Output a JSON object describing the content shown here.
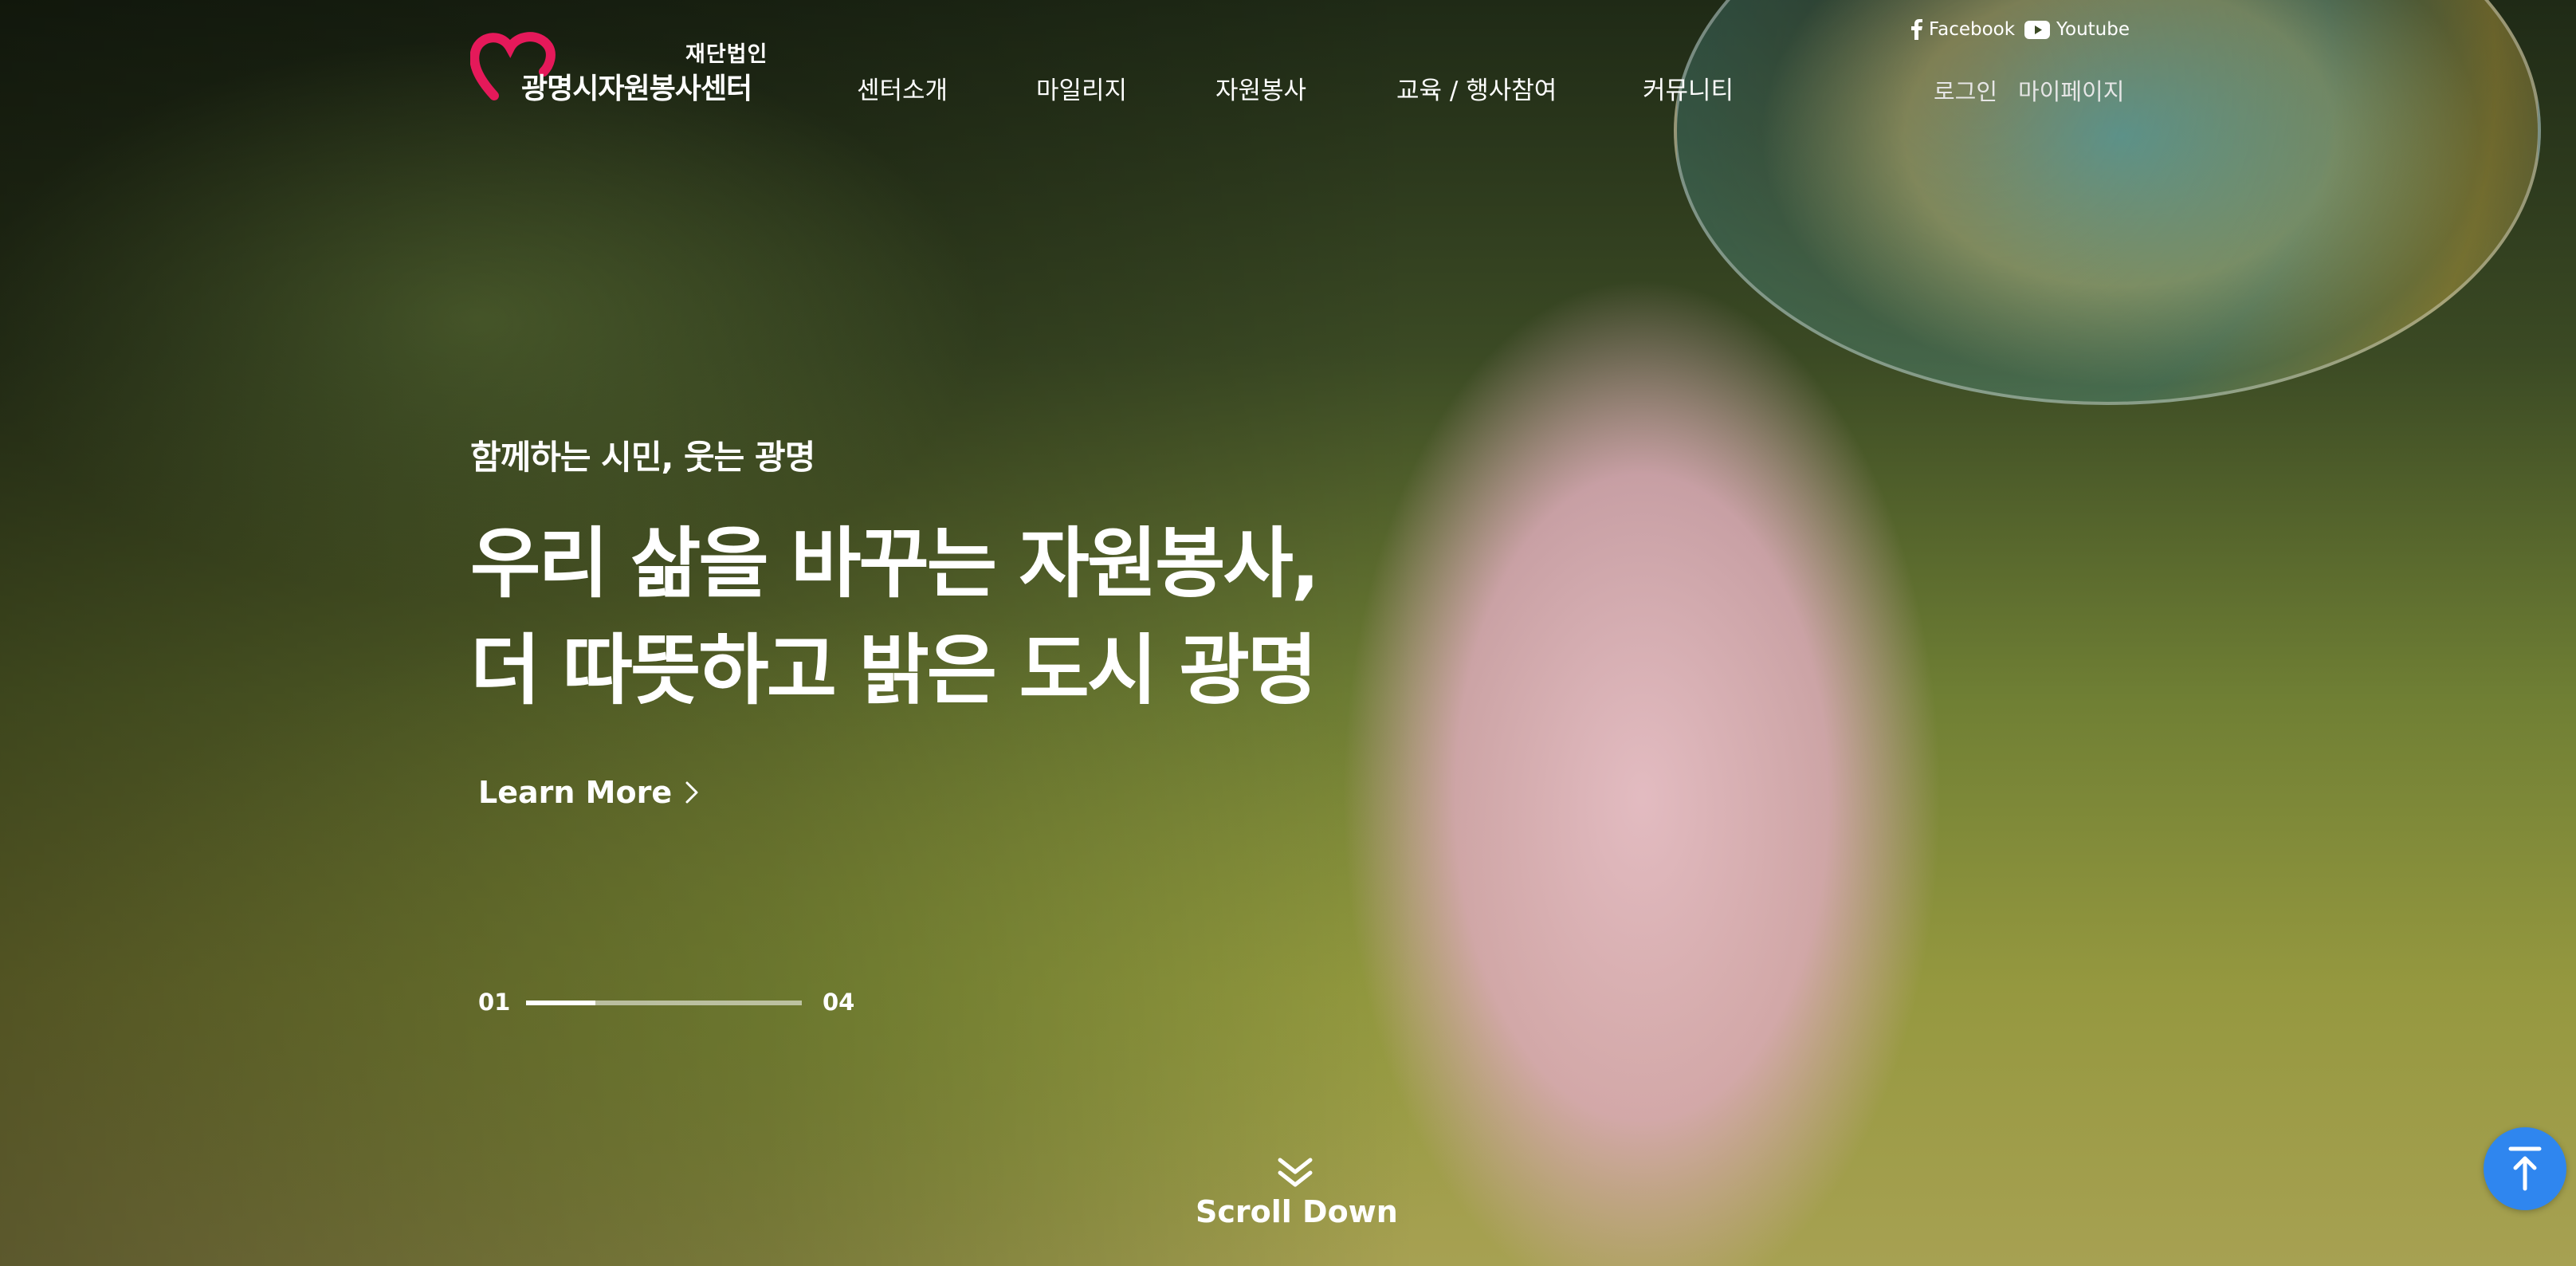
{
  "logo": {
    "small_text": "재단법인",
    "name": "광명시자원봉사센터",
    "icon": "heart-logo-icon",
    "brand_color": "#e5195a"
  },
  "nav": {
    "items": [
      {
        "label": "센터소개"
      },
      {
        "label": "마일리지"
      },
      {
        "label": "자원봉사"
      },
      {
        "label": "교육 / 행사참여"
      },
      {
        "label": "커뮤니티"
      }
    ]
  },
  "social": {
    "facebook": {
      "label": "Facebook",
      "icon": "facebook-icon"
    },
    "youtube": {
      "label": "Youtube",
      "icon": "youtube-icon"
    }
  },
  "util": {
    "login": "로그인",
    "mypage": "마이페이지"
  },
  "hero": {
    "kicker": "함께하는 시민, 웃는 광명",
    "headline": [
      "우리 삶을 바꾸는 자원봉사,",
      "더 따뜻하고 밝은 도시 광명"
    ],
    "cta": "Learn More",
    "cta_icon": "chevron-right-icon"
  },
  "slider": {
    "current": "01",
    "total": "04",
    "progress": 0.25
  },
  "scroll": {
    "label": "Scroll Down",
    "icon": "double-chevron-down-icon"
  },
  "top_button": {
    "icon": "arrow-up-to-top-icon",
    "color": "#2f86ef"
  }
}
